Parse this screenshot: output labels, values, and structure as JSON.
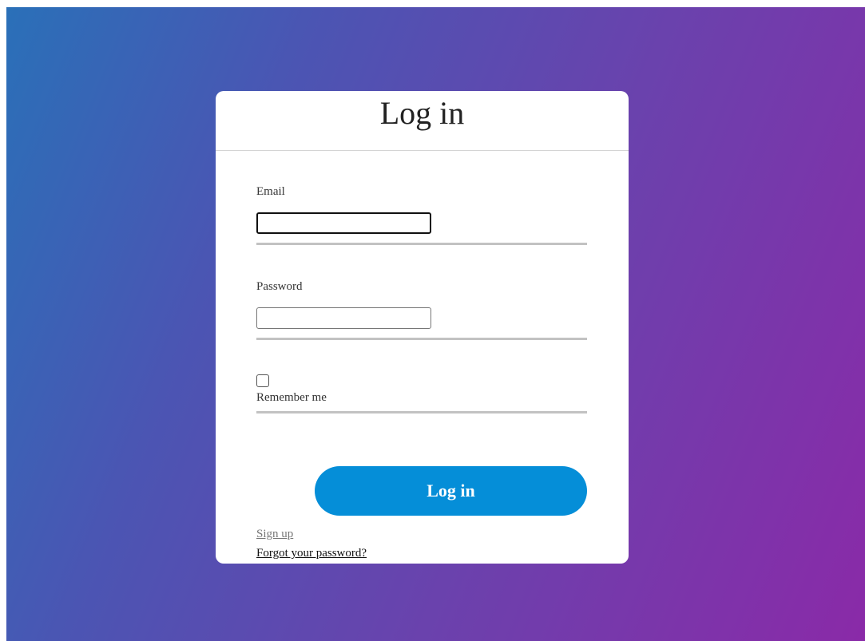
{
  "page": {
    "background_colors": [
      "#2a70b8",
      "#8a2aa8"
    ]
  },
  "form": {
    "title": "Log in",
    "email_label": "Email",
    "email_value": "",
    "password_label": "Password",
    "password_value": "",
    "remember_label": "Remember me",
    "remember_checked": false,
    "submit_label": "Log in",
    "submit_color": "#058ed8",
    "signup_link": "Sign up",
    "forgot_link": "Forgot your password?"
  }
}
